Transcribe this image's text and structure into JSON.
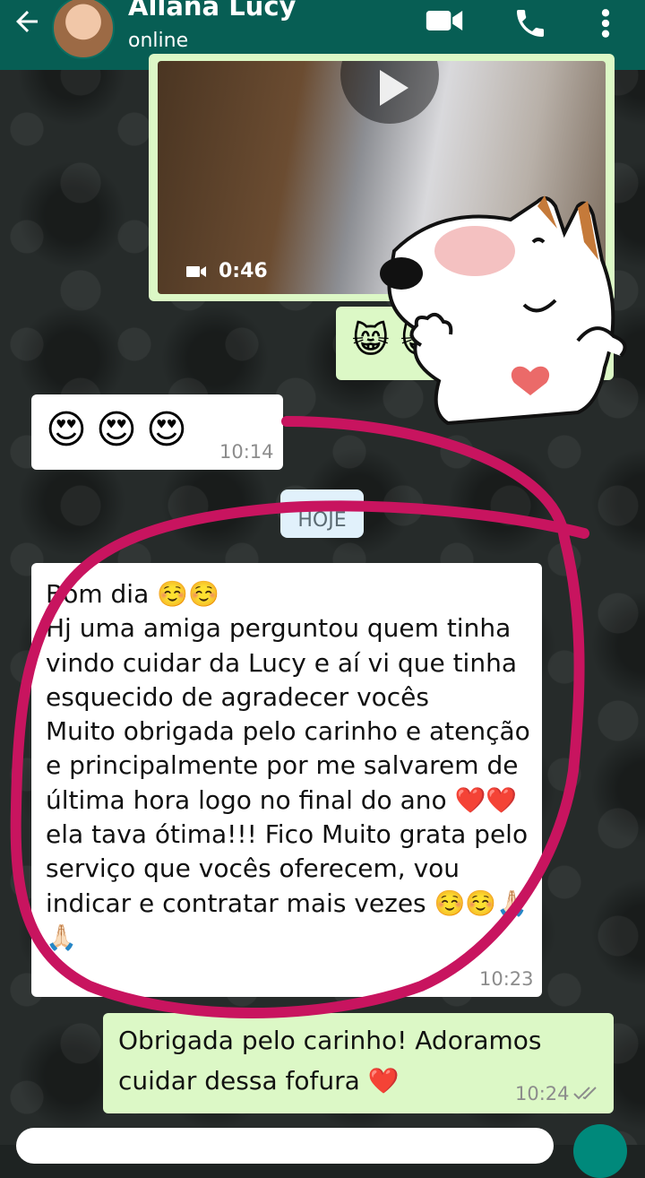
{
  "header": {
    "contact_name": "Allana Lucy",
    "status": "online",
    "icons": [
      "back-arrow-icon",
      "video-call-icon",
      "phone-call-icon",
      "more-options-icon"
    ],
    "color": "#075e54"
  },
  "messages": {
    "video": {
      "duration": "0:46"
    },
    "emoji_outgoing": {
      "emojis": [
        "😸",
        "😸"
      ]
    },
    "emoji_incoming": {
      "emojis": [
        "😍",
        "😍",
        "😍"
      ],
      "time": "10:14"
    },
    "date_chip": "HOJE",
    "long_incoming": {
      "text": "Bom dia ☺️☺️\nHj uma amiga perguntou quem tinha vindo cuidar da Lucy e aí vi que tinha esquecido de agradecer vocês\nMuito obrigada pelo carinho e atenção e principalmente por me salvarem de última hora logo no final do ano ❤️❤️ ela tava ótima!!! Fico Muito grata pelo serviço que vocês oferecem, vou indicar e contratar mais vezes ☺️☺️🙏🏻 🙏🏻",
      "time": "10:23"
    },
    "reply_outgoing": {
      "text": "Obrigada pelo carinho! Adoramos cuidar dessa fofura ❤️",
      "time": "10:24"
    }
  },
  "colors": {
    "incoming_bubble": "#ffffff",
    "outgoing_bubble": "#dcf8c6",
    "annotation_circle": "#c8145f"
  }
}
